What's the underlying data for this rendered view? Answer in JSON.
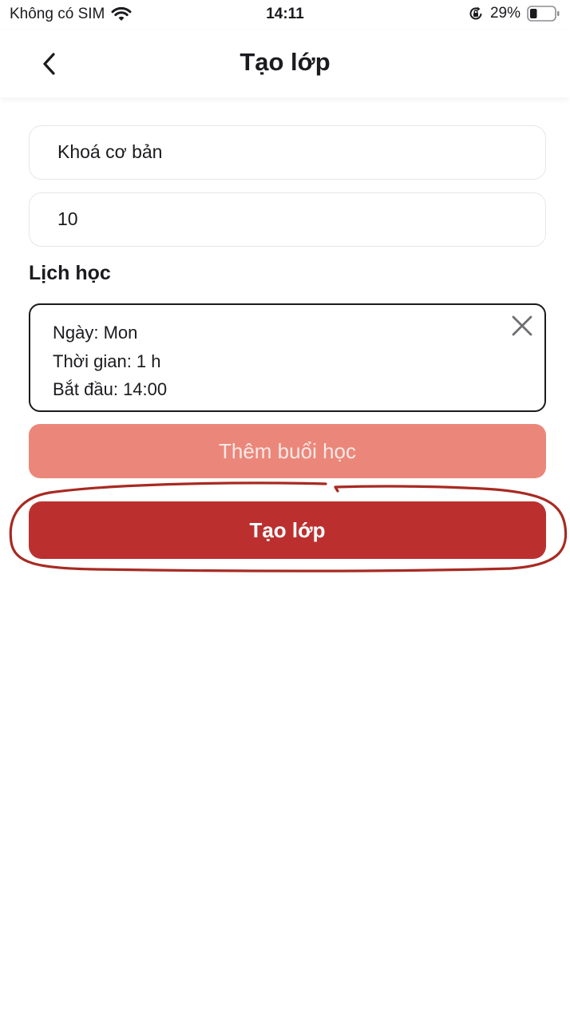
{
  "status_bar": {
    "carrier": "Không có SIM",
    "time": "14:11",
    "battery": "29%",
    "icons": [
      "wifi-icon",
      "orientation-lock-icon",
      "battery-icon"
    ]
  },
  "header": {
    "title": "Tạo lớp",
    "back_icon": "chevron-left-icon"
  },
  "form": {
    "course_name_value": "Khoá cơ bản",
    "student_count_value": "10"
  },
  "schedule": {
    "label": "Lịch học",
    "items": [
      {
        "day": "Ngày: Mon",
        "duration": "Thời gian: 1 h",
        "start": "Bắt đầu: 14:00"
      }
    ]
  },
  "buttons": {
    "add_session": "Thêm buổi học",
    "create_class": "Tạo lớp"
  },
  "colors": {
    "primary": "#bb302f",
    "secondary": "#eb877a",
    "annotation": "#a82a22"
  }
}
